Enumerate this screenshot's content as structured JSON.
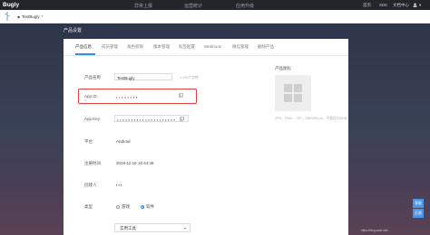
{
  "topbar": {
    "logo": "Bugly",
    "nav": [
      "异常上报",
      "运营统计",
      "应用升级"
    ],
    "right": [
      "首页",
      "SDK",
      "文档中心"
    ]
  },
  "subbar": {
    "app_name": "TestBugly"
  },
  "section_title": "产品设置",
  "tabs": [
    "产品信息",
    "成员管理",
    "角色权限",
    "版本管理",
    "标签配置",
    "Webhook",
    "微信管理",
    "删除产品"
  ],
  "form": {
    "product_name": {
      "label": "产品名称",
      "value": "TestBugly",
      "hint": "1 /20个字符"
    },
    "app_id": {
      "label": "App ID",
      "value": "• • ▪ ▪ • ▪ ▪ ▪"
    },
    "app_key": {
      "label": "App Key",
      "value": "• • ▪ • ▪ ▪ ▪ ▪ • ▪ • ▪ ▪ ▪ • • ▪ • ▪ ▪ ▪"
    },
    "platform": {
      "label": "平台",
      "value": "Android"
    },
    "register_time": {
      "label": "注册时间",
      "value": "2019-11-19 10:44:46"
    },
    "creator": {
      "label": "创建人",
      "value": "▪ ▪ ▪"
    },
    "type": {
      "label": "类型",
      "options": [
        "游戏",
        "软件"
      ],
      "selected": "软件"
    },
    "category": {
      "value": "实用工具"
    }
  },
  "product_icon": {
    "title": "产品图标",
    "hint": "JPG、PNG、GIF，256*256 px，不超过200KB"
  },
  "side_buttons": [
    "客服",
    "反馈"
  ],
  "watermark": "https://blog.csdn.net/..."
}
